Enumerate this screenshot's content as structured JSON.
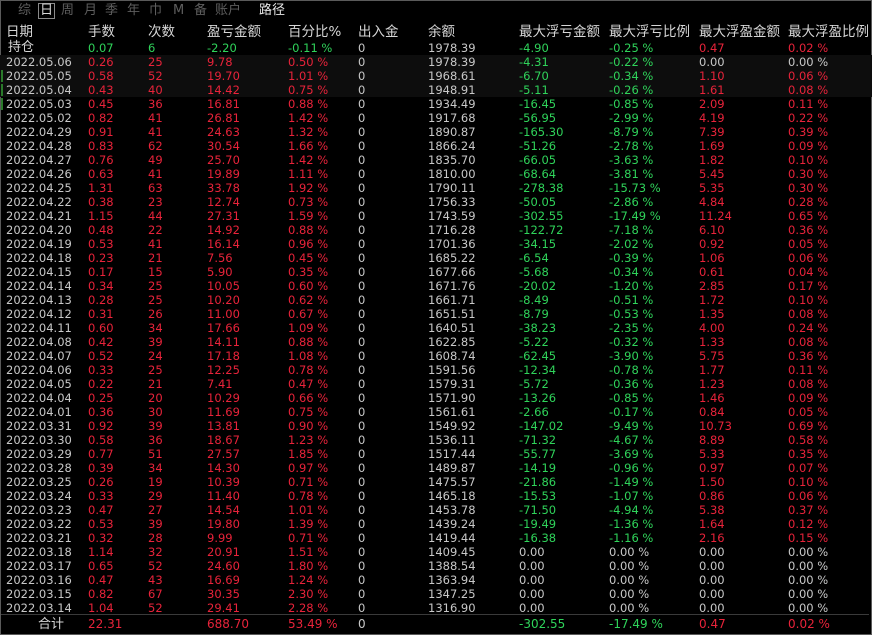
{
  "tabs": [
    {
      "label": "综",
      "state": "dim"
    },
    {
      "label": "日",
      "state": "active"
    },
    {
      "label": "周",
      "state": "dim"
    },
    {
      "label": "月",
      "state": "dim"
    },
    {
      "label": "季",
      "state": "dim"
    },
    {
      "label": "年",
      "state": "dim"
    },
    {
      "label": "巾",
      "state": "dim"
    },
    {
      "label": "M",
      "state": "dim"
    },
    {
      "label": "备",
      "state": "dim"
    },
    {
      "label": "账户",
      "state": "dim"
    },
    {
      "label": "路径",
      "state": "bright"
    }
  ],
  "columns": [
    "日期",
    "手数",
    "次数",
    "盈亏金额",
    "百分比%",
    "出入金",
    "余额",
    "最大浮亏金额",
    "最大浮亏比例",
    "最大浮盈金额",
    "最大浮盈比例"
  ],
  "holding": {
    "date": "持仓",
    "lots": "0.07",
    "trades": "6",
    "pnl": "-2.20",
    "pct": "-0.11 %",
    "flow": "0",
    "balance": "1978.39",
    "max_float_loss": "-4.90",
    "max_float_loss_pct": "-0.25 %",
    "max_float_profit": "0.47",
    "max_float_profit_pct": "0.02 %"
  },
  "rows": [
    {
      "date": "2022.05.06",
      "lots": "0.26",
      "trades": "25",
      "pnl": "9.78",
      "pct": "0.50 %",
      "flow": "0",
      "balance": "1978.39",
      "mfl": "-4.31",
      "mflp": "-0.22 %",
      "mfp": "0.00",
      "mfpp": "0.00 %"
    },
    {
      "date": "2022.05.05",
      "lots": "0.58",
      "trades": "52",
      "pnl": "19.70",
      "pct": "1.01 %",
      "flow": "0",
      "balance": "1968.61",
      "mfl": "-6.70",
      "mflp": "-0.34 %",
      "mfp": "1.10",
      "mfpp": "0.06 %"
    },
    {
      "date": "2022.05.04",
      "lots": "0.43",
      "trades": "40",
      "pnl": "14.42",
      "pct": "0.75 %",
      "flow": "0",
      "balance": "1948.91",
      "mfl": "-5.11",
      "mflp": "-0.26 %",
      "mfp": "1.61",
      "mfpp": "0.08 %"
    },
    {
      "date": "2022.05.03",
      "lots": "0.45",
      "trades": "36",
      "pnl": "16.81",
      "pct": "0.88 %",
      "flow": "0",
      "balance": "1934.49",
      "mfl": "-16.45",
      "mflp": "-0.85 %",
      "mfp": "2.09",
      "mfpp": "0.11 %"
    },
    {
      "date": "2022.05.02",
      "lots": "0.82",
      "trades": "41",
      "pnl": "26.81",
      "pct": "1.42 %",
      "flow": "0",
      "balance": "1917.68",
      "mfl": "-56.95",
      "mflp": "-2.99 %",
      "mfp": "4.19",
      "mfpp": "0.22 %"
    },
    {
      "date": "2022.04.29",
      "lots": "0.91",
      "trades": "41",
      "pnl": "24.63",
      "pct": "1.32 %",
      "flow": "0",
      "balance": "1890.87",
      "mfl": "-165.30",
      "mflp": "-8.79 %",
      "mfp": "7.39",
      "mfpp": "0.39 %"
    },
    {
      "date": "2022.04.28",
      "lots": "0.83",
      "trades": "62",
      "pnl": "30.54",
      "pct": "1.66 %",
      "flow": "0",
      "balance": "1866.24",
      "mfl": "-51.26",
      "mflp": "-2.78 %",
      "mfp": "1.69",
      "mfpp": "0.09 %"
    },
    {
      "date": "2022.04.27",
      "lots": "0.76",
      "trades": "49",
      "pnl": "25.70",
      "pct": "1.42 %",
      "flow": "0",
      "balance": "1835.70",
      "mfl": "-66.05",
      "mflp": "-3.63 %",
      "mfp": "1.82",
      "mfpp": "0.10 %"
    },
    {
      "date": "2022.04.26",
      "lots": "0.63",
      "trades": "41",
      "pnl": "19.89",
      "pct": "1.11 %",
      "flow": "0",
      "balance": "1810.00",
      "mfl": "-68.64",
      "mflp": "-3.81 %",
      "mfp": "5.45",
      "mfpp": "0.30 %"
    },
    {
      "date": "2022.04.25",
      "lots": "1.31",
      "trades": "63",
      "pnl": "33.78",
      "pct": "1.92 %",
      "flow": "0",
      "balance": "1790.11",
      "mfl": "-278.38",
      "mflp": "-15.73 %",
      "mfp": "5.35",
      "mfpp": "0.30 %"
    },
    {
      "date": "2022.04.22",
      "lots": "0.38",
      "trades": "23",
      "pnl": "12.74",
      "pct": "0.73 %",
      "flow": "0",
      "balance": "1756.33",
      "mfl": "-50.05",
      "mflp": "-2.86 %",
      "mfp": "4.84",
      "mfpp": "0.28 %"
    },
    {
      "date": "2022.04.21",
      "lots": "1.15",
      "trades": "44",
      "pnl": "27.31",
      "pct": "1.59 %",
      "flow": "0",
      "balance": "1743.59",
      "mfl": "-302.55",
      "mflp": "-17.49 %",
      "mfp": "11.24",
      "mfpp": "0.65 %"
    },
    {
      "date": "2022.04.20",
      "lots": "0.48",
      "trades": "22",
      "pnl": "14.92",
      "pct": "0.88 %",
      "flow": "0",
      "balance": "1716.28",
      "mfl": "-122.72",
      "mflp": "-7.18 %",
      "mfp": "6.10",
      "mfpp": "0.36 %"
    },
    {
      "date": "2022.04.19",
      "lots": "0.53",
      "trades": "41",
      "pnl": "16.14",
      "pct": "0.96 %",
      "flow": "0",
      "balance": "1701.36",
      "mfl": "-34.15",
      "mflp": "-2.02 %",
      "mfp": "0.92",
      "mfpp": "0.05 %"
    },
    {
      "date": "2022.04.18",
      "lots": "0.23",
      "trades": "21",
      "pnl": "7.56",
      "pct": "0.45 %",
      "flow": "0",
      "balance": "1685.22",
      "mfl": "-6.54",
      "mflp": "-0.39 %",
      "mfp": "1.06",
      "mfpp": "0.06 %"
    },
    {
      "date": "2022.04.15",
      "lots": "0.17",
      "trades": "15",
      "pnl": "5.90",
      "pct": "0.35 %",
      "flow": "0",
      "balance": "1677.66",
      "mfl": "-5.68",
      "mflp": "-0.34 %",
      "mfp": "0.61",
      "mfpp": "0.04 %"
    },
    {
      "date": "2022.04.14",
      "lots": "0.34",
      "trades": "25",
      "pnl": "10.05",
      "pct": "0.60 %",
      "flow": "0",
      "balance": "1671.76",
      "mfl": "-20.02",
      "mflp": "-1.20 %",
      "mfp": "2.85",
      "mfpp": "0.17 %"
    },
    {
      "date": "2022.04.13",
      "lots": "0.28",
      "trades": "25",
      "pnl": "10.20",
      "pct": "0.62 %",
      "flow": "0",
      "balance": "1661.71",
      "mfl": "-8.49",
      "mflp": "-0.51 %",
      "mfp": "1.72",
      "mfpp": "0.10 %"
    },
    {
      "date": "2022.04.12",
      "lots": "0.31",
      "trades": "26",
      "pnl": "11.00",
      "pct": "0.67 %",
      "flow": "0",
      "balance": "1651.51",
      "mfl": "-8.79",
      "mflp": "-0.53 %",
      "mfp": "1.35",
      "mfpp": "0.08 %"
    },
    {
      "date": "2022.04.11",
      "lots": "0.60",
      "trades": "34",
      "pnl": "17.66",
      "pct": "1.09 %",
      "flow": "0",
      "balance": "1640.51",
      "mfl": "-38.23",
      "mflp": "-2.35 %",
      "mfp": "4.00",
      "mfpp": "0.24 %"
    },
    {
      "date": "2022.04.08",
      "lots": "0.42",
      "trades": "39",
      "pnl": "14.11",
      "pct": "0.88 %",
      "flow": "0",
      "balance": "1622.85",
      "mfl": "-5.22",
      "mflp": "-0.32 %",
      "mfp": "1.33",
      "mfpp": "0.08 %"
    },
    {
      "date": "2022.04.07",
      "lots": "0.52",
      "trades": "24",
      "pnl": "17.18",
      "pct": "1.08 %",
      "flow": "0",
      "balance": "1608.74",
      "mfl": "-62.45",
      "mflp": "-3.90 %",
      "mfp": "5.75",
      "mfpp": "0.36 %"
    },
    {
      "date": "2022.04.06",
      "lots": "0.33",
      "trades": "25",
      "pnl": "12.25",
      "pct": "0.78 %",
      "flow": "0",
      "balance": "1591.56",
      "mfl": "-12.34",
      "mflp": "-0.78 %",
      "mfp": "1.77",
      "mfpp": "0.11 %"
    },
    {
      "date": "2022.04.05",
      "lots": "0.22",
      "trades": "21",
      "pnl": "7.41",
      "pct": "0.47 %",
      "flow": "0",
      "balance": "1579.31",
      "mfl": "-5.72",
      "mflp": "-0.36 %",
      "mfp": "1.23",
      "mfpp": "0.08 %"
    },
    {
      "date": "2022.04.04",
      "lots": "0.25",
      "trades": "20",
      "pnl": "10.29",
      "pct": "0.66 %",
      "flow": "0",
      "balance": "1571.90",
      "mfl": "-13.26",
      "mflp": "-0.85 %",
      "mfp": "1.46",
      "mfpp": "0.09 %"
    },
    {
      "date": "2022.04.01",
      "lots": "0.36",
      "trades": "30",
      "pnl": "11.69",
      "pct": "0.75 %",
      "flow": "0",
      "balance": "1561.61",
      "mfl": "-2.66",
      "mflp": "-0.17 %",
      "mfp": "0.84",
      "mfpp": "0.05 %"
    },
    {
      "date": "2022.03.31",
      "lots": "0.92",
      "trades": "39",
      "pnl": "13.81",
      "pct": "0.90 %",
      "flow": "0",
      "balance": "1549.92",
      "mfl": "-147.02",
      "mflp": "-9.49 %",
      "mfp": "10.73",
      "mfpp": "0.69 %"
    },
    {
      "date": "2022.03.30",
      "lots": "0.58",
      "trades": "36",
      "pnl": "18.67",
      "pct": "1.23 %",
      "flow": "0",
      "balance": "1536.11",
      "mfl": "-71.32",
      "mflp": "-4.67 %",
      "mfp": "8.89",
      "mfpp": "0.58 %"
    },
    {
      "date": "2022.03.29",
      "lots": "0.77",
      "trades": "51",
      "pnl": "27.57",
      "pct": "1.85 %",
      "flow": "0",
      "balance": "1517.44",
      "mfl": "-55.77",
      "mflp": "-3.69 %",
      "mfp": "5.33",
      "mfpp": "0.35 %"
    },
    {
      "date": "2022.03.28",
      "lots": "0.39",
      "trades": "34",
      "pnl": "14.30",
      "pct": "0.97 %",
      "flow": "0",
      "balance": "1489.87",
      "mfl": "-14.19",
      "mflp": "-0.96 %",
      "mfp": "0.97",
      "mfpp": "0.07 %"
    },
    {
      "date": "2022.03.25",
      "lots": "0.26",
      "trades": "19",
      "pnl": "10.39",
      "pct": "0.71 %",
      "flow": "0",
      "balance": "1475.57",
      "mfl": "-21.86",
      "mflp": "-1.49 %",
      "mfp": "1.50",
      "mfpp": "0.10 %"
    },
    {
      "date": "2022.03.24",
      "lots": "0.33",
      "trades": "29",
      "pnl": "11.40",
      "pct": "0.78 %",
      "flow": "0",
      "balance": "1465.18",
      "mfl": "-15.53",
      "mflp": "-1.07 %",
      "mfp": "0.86",
      "mfpp": "0.06 %"
    },
    {
      "date": "2022.03.23",
      "lots": "0.47",
      "trades": "27",
      "pnl": "14.54",
      "pct": "1.01 %",
      "flow": "0",
      "balance": "1453.78",
      "mfl": "-71.50",
      "mflp": "-4.94 %",
      "mfp": "5.38",
      "mfpp": "0.37 %"
    },
    {
      "date": "2022.03.22",
      "lots": "0.53",
      "trades": "39",
      "pnl": "19.80",
      "pct": "1.39 %",
      "flow": "0",
      "balance": "1439.24",
      "mfl": "-19.49",
      "mflp": "-1.36 %",
      "mfp": "1.64",
      "mfpp": "0.12 %"
    },
    {
      "date": "2022.03.21",
      "lots": "0.32",
      "trades": "28",
      "pnl": "9.99",
      "pct": "0.71 %",
      "flow": "0",
      "balance": "1419.44",
      "mfl": "-16.38",
      "mflp": "-1.16 %",
      "mfp": "2.16",
      "mfpp": "0.15 %"
    },
    {
      "date": "2022.03.18",
      "lots": "1.14",
      "trades": "32",
      "pnl": "20.91",
      "pct": "1.51 %",
      "flow": "0",
      "balance": "1409.45",
      "mfl": "0.00",
      "mflp": "0.00 %",
      "mfp": "0.00",
      "mfpp": "0.00 %"
    },
    {
      "date": "2022.03.17",
      "lots": "0.65",
      "trades": "52",
      "pnl": "24.60",
      "pct": "1.80 %",
      "flow": "0",
      "balance": "1388.54",
      "mfl": "0.00",
      "mflp": "0.00 %",
      "mfp": "0.00",
      "mfpp": "0.00 %"
    },
    {
      "date": "2022.03.16",
      "lots": "0.47",
      "trades": "43",
      "pnl": "16.69",
      "pct": "1.24 %",
      "flow": "0",
      "balance": "1363.94",
      "mfl": "0.00",
      "mflp": "0.00 %",
      "mfp": "0.00",
      "mfpp": "0.00 %"
    },
    {
      "date": "2022.03.15",
      "lots": "0.82",
      "trades": "67",
      "pnl": "30.35",
      "pct": "2.30 %",
      "flow": "0",
      "balance": "1347.25",
      "mfl": "0.00",
      "mflp": "0.00 %",
      "mfp": "0.00",
      "mfpp": "0.00 %"
    },
    {
      "date": "2022.03.14",
      "lots": "1.04",
      "trades": "52",
      "pnl": "29.41",
      "pct": "2.28 %",
      "flow": "0",
      "balance": "1316.90",
      "mfl": "0.00",
      "mflp": "0.00 %",
      "mfp": "0.00",
      "mfpp": "0.00 %"
    }
  ],
  "total": {
    "label": "合计",
    "lots": "22.31",
    "pnl": "688.70",
    "pct": "53.49 %",
    "flow": "0",
    "mfl": "-302.55",
    "mflp": "-17.49 %",
    "mfp": "0.47",
    "mfpp": "0.02 %"
  },
  "colors": {
    "positive": "#e8233a",
    "negative": "#2fd35a",
    "neutral": "#c8c8c8",
    "background": "#000000"
  }
}
